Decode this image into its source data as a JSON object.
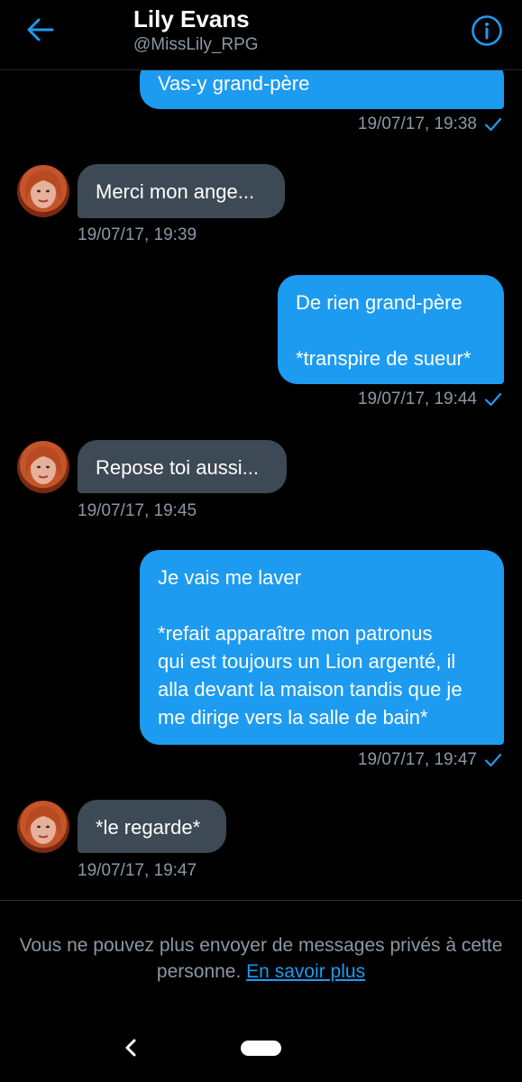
{
  "header": {
    "title": "Lily Evans",
    "handle": "@MissLily_RPG"
  },
  "messages": [
    {
      "direction": "sent",
      "text": "Vas-y grand-père",
      "timestamp": "19/07/17, 19:38"
    },
    {
      "direction": "received",
      "text": "Merci mon ange...",
      "timestamp": "19/07/17, 19:39"
    },
    {
      "direction": "sent",
      "text": "De rien grand-père\n\n*transpire de sueur*",
      "timestamp": "19/07/17, 19:44"
    },
    {
      "direction": "received",
      "text": "Repose toi aussi...",
      "timestamp": "19/07/17, 19:45"
    },
    {
      "direction": "sent",
      "text": "Je vais me laver\n\n*refait apparaître mon patronus\nqui est toujours un Lion argenté, il\nalla devant la maison tandis que je\nme dirige vers la salle de bain*",
      "timestamp": "19/07/17, 19:47"
    },
    {
      "direction": "received",
      "text": "*le regarde*",
      "timestamp": "19/07/17, 19:47"
    }
  ],
  "footer": {
    "notice": "Vous ne pouvez plus envoyer de messages privés à cette personne.",
    "link": "En savoir plus"
  },
  "colors": {
    "accent": "#1d9bf0",
    "received_bubble": "#3d4a55",
    "muted_text": "#8b98a5",
    "background": "#000000"
  },
  "icons": {
    "back": "arrow-left-icon",
    "info": "info-icon",
    "read": "check-icon",
    "nav_back": "chevron-left-icon"
  }
}
